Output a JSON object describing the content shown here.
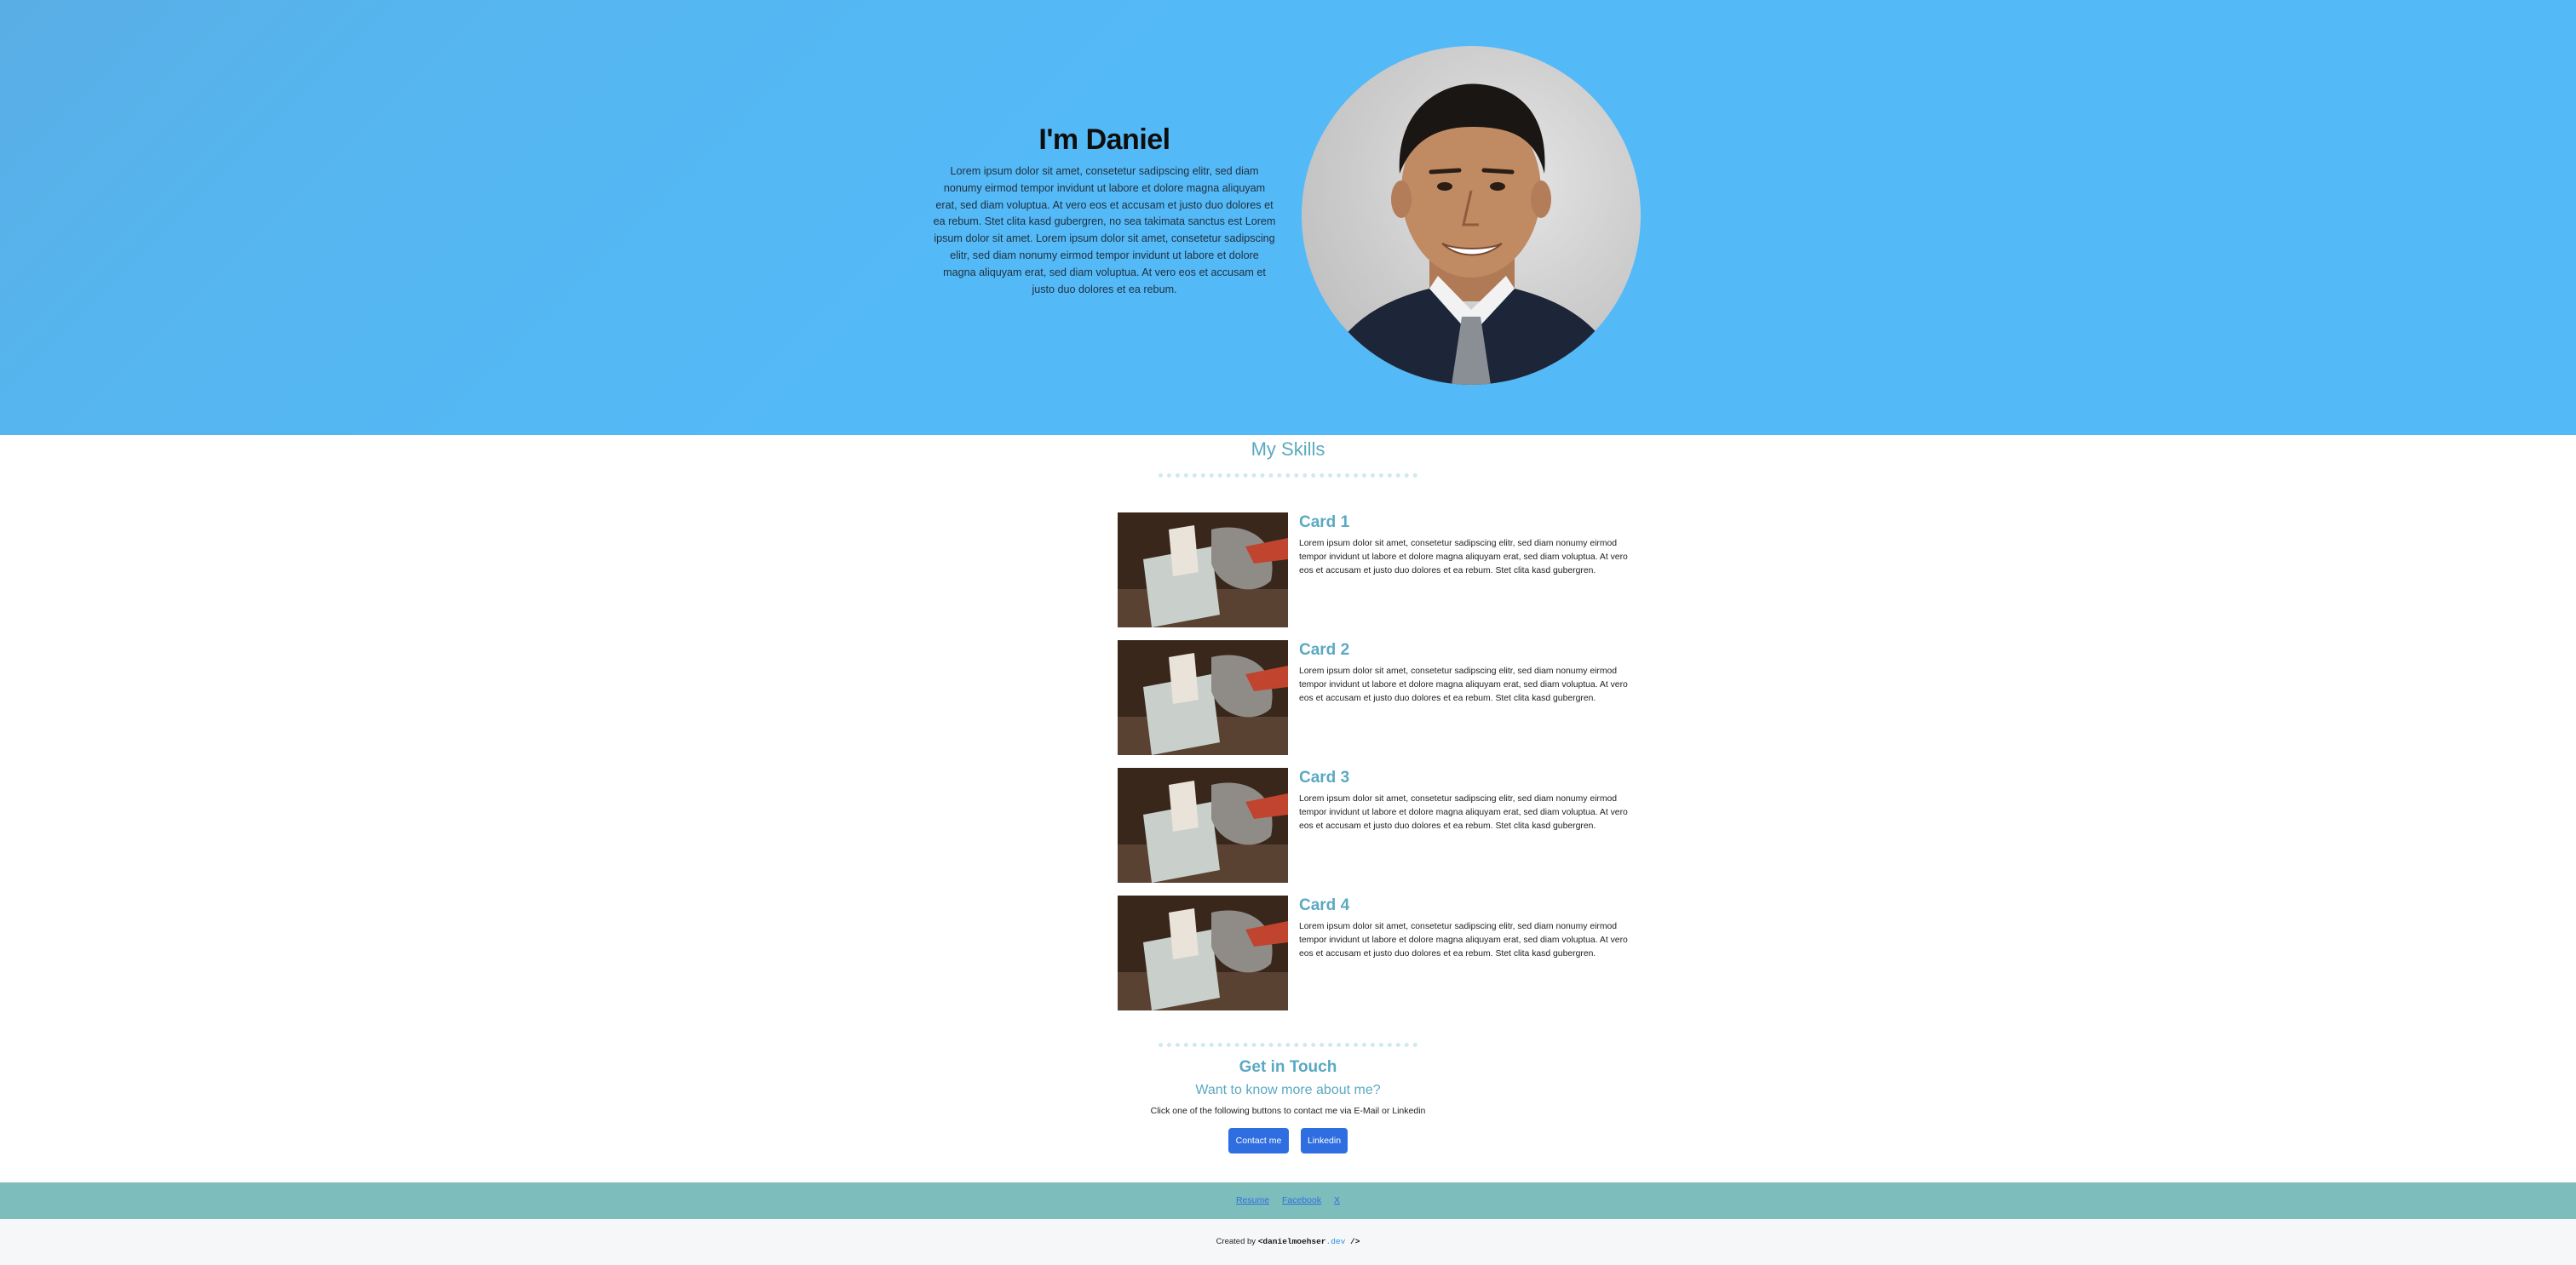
{
  "hero": {
    "title": "I'm Daniel",
    "description": "Lorem ipsum dolor sit amet, consetetur sadipscing elitr, sed diam nonumy eirmod tempor invidunt ut labore et dolore magna aliquyam erat, sed diam voluptua. At vero eos et accusam et justo duo dolores et ea rebum. Stet clita kasd gubergren, no sea takimata sanctus est Lorem ipsum dolor sit amet. Lorem ipsum dolor sit amet, consetetur sadipscing elitr, sed diam nonumy eirmod tempor invidunt ut labore et dolore magna aliquyam erat, sed diam voluptua. At vero eos et accusam et justo duo dolores et ea rebum."
  },
  "skills": {
    "title": "My Skills",
    "cards": [
      {
        "title": "Card 1",
        "text": "Lorem ipsum dolor sit amet, consetetur sadipscing elitr, sed diam nonumy eirmod tempor invidunt ut labore et dolore magna aliquyam erat, sed diam voluptua. At vero eos et accusam et justo duo dolores et ea rebum. Stet clita kasd gubergren."
      },
      {
        "title": "Card 2",
        "text": "Lorem ipsum dolor sit amet, consetetur sadipscing elitr, sed diam nonumy eirmod tempor invidunt ut labore et dolore magna aliquyam erat, sed diam voluptua. At vero eos et accusam et justo duo dolores et ea rebum. Stet clita kasd gubergren."
      },
      {
        "title": "Card 3",
        "text": "Lorem ipsum dolor sit amet, consetetur sadipscing elitr, sed diam nonumy eirmod tempor invidunt ut labore et dolore magna aliquyam erat, sed diam voluptua. At vero eos et accusam et justo duo dolores et ea rebum. Stet clita kasd gubergren."
      },
      {
        "title": "Card 4",
        "text": "Lorem ipsum dolor sit amet, consetetur sadipscing elitr, sed diam nonumy eirmod tempor invidunt ut labore et dolore magna aliquyam erat, sed diam voluptua. At vero eos et accusam et justo duo dolores et ea rebum. Stet clita kasd gubergren."
      }
    ]
  },
  "contact": {
    "title": "Get in Touch",
    "subtitle": "Want to know more about me?",
    "note": "Click one of the following buttons to contact me via E-Mail or Linkedin",
    "contact_button": "Contact me",
    "linkedin_button": "Linkedin"
  },
  "footer": {
    "links": [
      "Resume",
      "Facebook",
      "X"
    ],
    "credit_prefix": "Created by ",
    "credit_open": "<",
    "credit_name": "danielmoehser",
    "credit_domain": ".dev",
    "credit_close": " />"
  },
  "colors": {
    "hero_bg": "#54b9f7",
    "accent_teal": "#5aa9c2",
    "button_blue": "#2f6ee0",
    "footer_bar": "#7dbdbb"
  }
}
